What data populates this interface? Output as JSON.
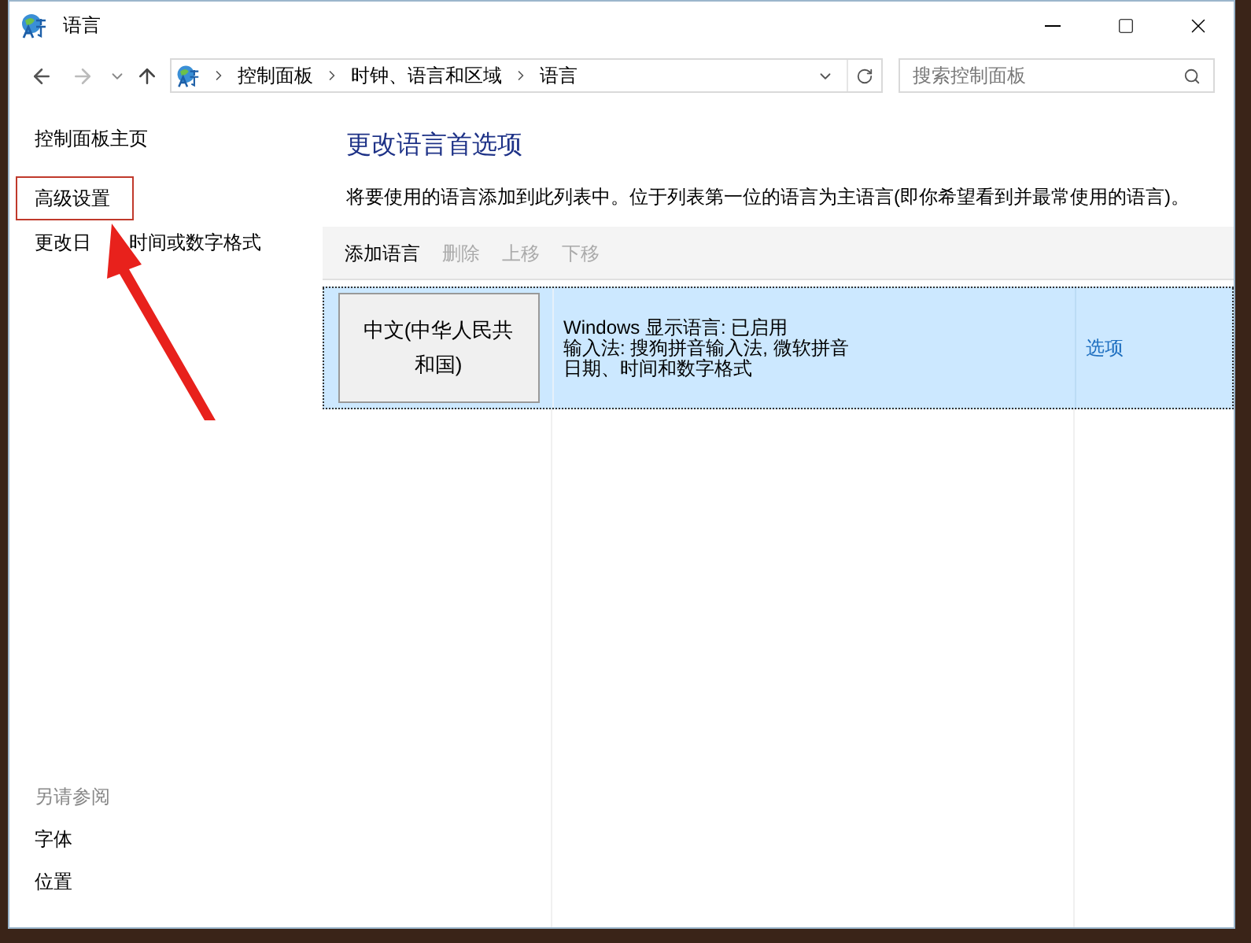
{
  "window": {
    "title": "语言"
  },
  "address_bar": {
    "segments": [
      "控制面板",
      "时钟、语言和区域",
      "语言"
    ]
  },
  "search": {
    "placeholder": "搜索控制面板"
  },
  "sidebar": {
    "items": [
      {
        "text": "控制面板主页",
        "highlighted": false
      },
      {
        "text": "高级设置",
        "highlighted": true
      },
      {
        "text": "更改日",
        "text_after": "时间或数字格式",
        "highlighted": false
      }
    ],
    "see_also": {
      "heading": "另请参阅",
      "items": [
        "字体",
        "位置"
      ]
    }
  },
  "content": {
    "title": "更改语言首选项",
    "description": "将要使用的语言添加到此列表中。位于列表第一位的语言为主语言(即你希望看到并最常使用的语言)。",
    "toolbar": [
      {
        "label": "添加语言",
        "disabled": false
      },
      {
        "label": "删除",
        "disabled": true
      },
      {
        "label": "上移",
        "disabled": true
      },
      {
        "label": "下移",
        "disabled": true
      }
    ],
    "languages": [
      {
        "name": "中文(中华人民共和国)",
        "details": [
          "Windows 显示语言: 已启用",
          "输入法: 搜狗拼音输入法, 微软拼音",
          "日期、时间和数字格式"
        ],
        "options": "选项",
        "selected": true
      }
    ]
  }
}
